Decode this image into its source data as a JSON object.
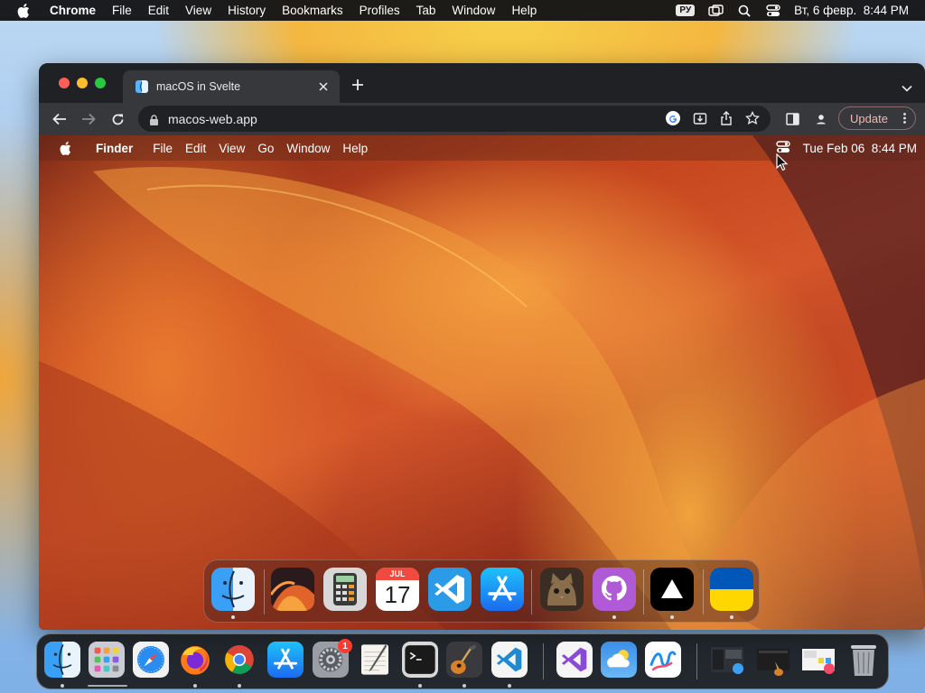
{
  "host_menubar": {
    "app_name": "Chrome",
    "items": [
      "File",
      "Edit",
      "View",
      "History",
      "Bookmarks",
      "Profiles",
      "Tab",
      "Window",
      "Help"
    ],
    "input_language": "РУ",
    "datetime": "Вт, 6 февр.  8:44 PM"
  },
  "browser": {
    "tab_title": "macOS in Svelte",
    "url": "macos-web.app",
    "update_label": "Update"
  },
  "web_macos": {
    "menubar": {
      "app_name": "Finder",
      "items": [
        "File",
        "Edit",
        "View",
        "Go",
        "Window",
        "Help"
      ],
      "datetime": "Tue Feb 06  8:44 PM"
    },
    "dock": [
      {
        "name": "Finder",
        "icon": "finder-icon",
        "running": true
      },
      {
        "name": "Wallpapers",
        "icon": "wallpapers-icon",
        "running": false
      },
      {
        "name": "Calculator",
        "icon": "calculator-icon",
        "running": false
      },
      {
        "name": "Calendar",
        "icon": "calendar-icon",
        "running": false,
        "month": "JUL",
        "day": "17"
      },
      {
        "name": "VS Code",
        "icon": "vscode-icon",
        "running": false
      },
      {
        "name": "App Store",
        "icon": "appstore-icon",
        "running": false
      },
      {
        "name": "Purrfect",
        "icon": "cat-icon",
        "running": false
      },
      {
        "name": "GitHub",
        "icon": "github-icon",
        "running": true
      },
      {
        "name": "Vercel",
        "icon": "vercel-icon",
        "running": true
      },
      {
        "name": "Ukraine",
        "icon": "ukraine-flag-icon",
        "running": true
      }
    ]
  },
  "host_dock": {
    "apps": [
      {
        "name": "Finder",
        "icon": "finder-icon",
        "running": true
      },
      {
        "name": "Launchpad",
        "icon": "launchpad-icon",
        "running": false
      },
      {
        "name": "Safari",
        "icon": "safari-icon",
        "running": false
      },
      {
        "name": "Firefox",
        "icon": "firefox-icon",
        "running": true
      },
      {
        "name": "Chrome",
        "icon": "chrome-icon",
        "running": true
      },
      {
        "name": "App Store",
        "icon": "appstore-icon",
        "running": false
      },
      {
        "name": "System Settings",
        "icon": "settings-icon",
        "running": false,
        "badge": "1"
      },
      {
        "name": "TextEdit",
        "icon": "textedit-icon",
        "running": false
      },
      {
        "name": "Terminal",
        "icon": "terminal-icon",
        "running": true
      },
      {
        "name": "GarageBand",
        "icon": "garageband-icon",
        "running": true
      },
      {
        "name": "VS Code",
        "icon": "vscode-icon",
        "running": true
      },
      {
        "name": "Visual Studio",
        "icon": "visualstudio-icon",
        "running": false
      },
      {
        "name": "Weather",
        "icon": "weather-icon",
        "running": false
      },
      {
        "name": "Freeform",
        "icon": "freeform-icon",
        "running": false
      },
      {
        "name": "Recent window 1",
        "icon": "window-thumbnail-icon",
        "running": false
      },
      {
        "name": "Recent window 2",
        "icon": "window-thumbnail-icon",
        "running": false
      },
      {
        "name": "Recent window 3",
        "icon": "window-thumbnail-icon",
        "running": false
      },
      {
        "name": "Trash",
        "icon": "trash-icon",
        "running": false
      }
    ]
  },
  "colors": {
    "close": "#fe5f57",
    "minimize": "#febc2e",
    "zoom": "#28c840",
    "update_text": "#f2b8b5",
    "badge": "#ff3b30"
  }
}
